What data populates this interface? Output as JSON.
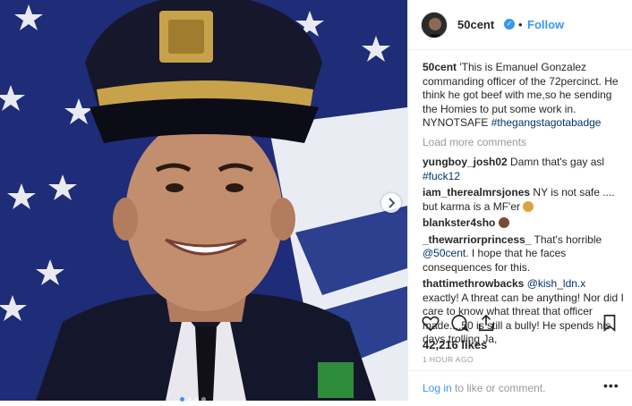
{
  "header": {
    "username": "50cent",
    "follow_label": "Follow",
    "separator": "•",
    "verified_glyph": "✓"
  },
  "post": {
    "caption_user": "50cent",
    "caption_text": "'This is Emanuel Gonzalez commanding officer of the 72percinct. He think he got beef with me,so he sending the Homies to put some work in. NYNOTSAFE",
    "caption_tag": "#thegangstagotabadge"
  },
  "load_more_label": "Load more comments",
  "comments": [
    {
      "user": "yungboy_josh02",
      "text": "Damn that's gay asl",
      "tag": "#fuck12"
    },
    {
      "user": "iam_therealmrsjones",
      "text": "NY is not safe .... but karma is a MF'er"
    },
    {
      "user": "blankster4sho",
      "text": ""
    },
    {
      "user": "_thewarriorprincess_",
      "text": "That's horrible",
      "mention": "@50cent.",
      "text2": "I hope that he faces consequences for this."
    },
    {
      "user": "thattimethrowbacks",
      "mention": "@kish_ldn.x",
      "text": "exactly! A threat can be anything! Nor did I care to know what threat that officer made....50 is still a bully! He spends his days trolling Ja,"
    }
  ],
  "likes_label": "42,216 likes",
  "timestamp": "1 HOUR AGO",
  "footer": {
    "login_link": "Log in",
    "login_rest": "to like or comment.",
    "more": "•••"
  },
  "icons": [
    "heart-icon",
    "comment-icon",
    "share-icon",
    "bookmark-icon",
    "next-arrow-icon"
  ],
  "carousel": {
    "count": 4,
    "active": 1
  },
  "colors": {
    "link": "#3897f0",
    "hashtag": "#003569",
    "muted": "#999999",
    "flag_blue": "#1f2c77",
    "cap_gold": "#c8a24a"
  }
}
